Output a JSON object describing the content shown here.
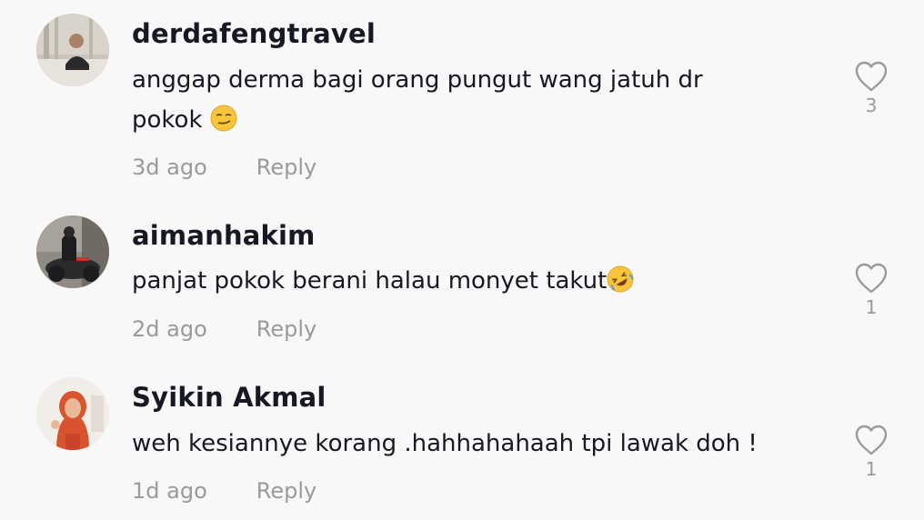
{
  "comments": [
    {
      "username": "derdafengtravel",
      "text_line1": "anggap derma bagi orang pungut wang jatuh dr",
      "text_line2": "pokok",
      "emoji": "smirking-face-emoji",
      "time": "3d ago",
      "reply_label": "Reply",
      "likes": "3"
    },
    {
      "username": "aimanhakim",
      "text_line1": "panjat pokok berani halau monyet takut",
      "emoji": "rolling-on-floor-laughing-emoji",
      "time": "2d ago",
      "reply_label": "Reply",
      "likes": "1"
    },
    {
      "username": "Syikin Akmal",
      "text_line1": "weh kesiannye korang .hahhahahaah tpi lawak doh !",
      "time": "1d ago",
      "reply_label": "Reply",
      "likes": "1"
    }
  ],
  "icons": {
    "like": "heart-outline-icon"
  },
  "colors": {
    "background": "#f8f8f8",
    "text": "#161823",
    "muted": "#9a9a9e"
  }
}
